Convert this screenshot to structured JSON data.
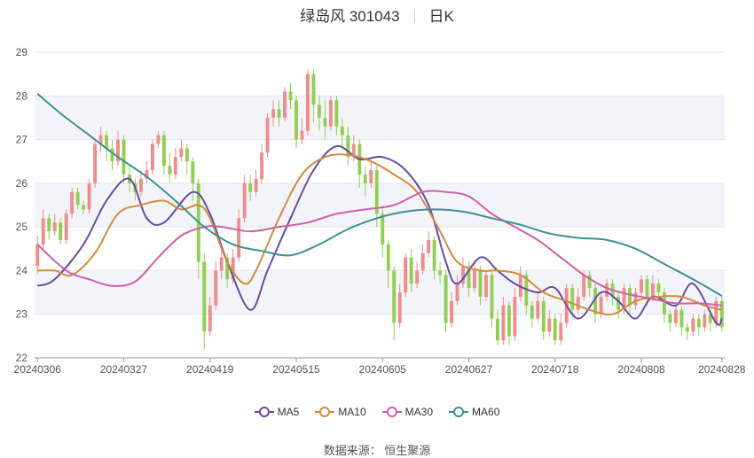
{
  "header": {
    "stock": "绿岛风 301043",
    "period": "日K"
  },
  "footer": {
    "source": "数据来源： 恒生聚源"
  },
  "colors": {
    "up": "#f28b8b",
    "down": "#8fd14f",
    "grid": "#e3e6ee",
    "band": "#f3f4f9"
  },
  "chart_data": {
    "type": "candlestick",
    "ylim": [
      22,
      29
    ],
    "yticks": [
      "22",
      "23",
      "24",
      "25",
      "26",
      "27",
      "28",
      "29"
    ],
    "xtick_labels": [
      "20240306",
      "20240327",
      "20240419",
      "20240515",
      "20240605",
      "20240627",
      "20240718",
      "20240808",
      "20240828"
    ],
    "xtick_index": [
      0,
      15,
      30,
      45,
      60,
      75,
      90,
      105,
      119
    ],
    "n_days": 120,
    "candles": [
      [
        24.1,
        24.6,
        23.9,
        24.8
      ],
      [
        24.6,
        25.2,
        24.5,
        25.4
      ],
      [
        25.2,
        24.9,
        24.7,
        25.3
      ],
      [
        24.9,
        25.1,
        24.8,
        25.3
      ],
      [
        25.1,
        24.7,
        24.6,
        25.2
      ],
      [
        24.7,
        25.3,
        24.6,
        25.4
      ],
      [
        25.3,
        25.8,
        25.2,
        25.9
      ],
      [
        25.8,
        25.5,
        25.4,
        25.9
      ],
      [
        25.5,
        25.4,
        25.3,
        25.6
      ],
      [
        25.4,
        26.0,
        25.3,
        26.1
      ],
      [
        26.0,
        26.9,
        25.9,
        27.0
      ],
      [
        26.9,
        27.1,
        26.7,
        27.3
      ],
      [
        27.1,
        26.8,
        26.5,
        27.2
      ],
      [
        26.8,
        26.5,
        26.3,
        27.0
      ],
      [
        26.5,
        27.0,
        26.4,
        27.2
      ],
      [
        27.0,
        26.2,
        26.0,
        27.1
      ],
      [
        26.2,
        26.0,
        25.8,
        26.4
      ],
      [
        26.0,
        25.8,
        25.6,
        26.1
      ],
      [
        25.8,
        26.1,
        25.7,
        26.3
      ],
      [
        26.1,
        26.3,
        26.0,
        26.5
      ],
      [
        26.3,
        26.9,
        26.2,
        27.0
      ],
      [
        26.9,
        27.1,
        26.8,
        27.2
      ],
      [
        27.1,
        26.4,
        26.2,
        27.2
      ],
      [
        26.4,
        26.2,
        26.0,
        26.7
      ],
      [
        26.2,
        26.6,
        26.1,
        26.8
      ],
      [
        26.6,
        26.8,
        26.5,
        27.0
      ],
      [
        26.8,
        26.5,
        26.2,
        26.9
      ],
      [
        26.5,
        26.0,
        25.6,
        26.6
      ],
      [
        26.0,
        24.2,
        23.8,
        26.1
      ],
      [
        24.2,
        22.6,
        22.2,
        24.4
      ],
      [
        22.6,
        23.2,
        22.5,
        23.4
      ],
      [
        23.2,
        24.0,
        23.1,
        24.2
      ],
      [
        24.0,
        24.3,
        23.8,
        24.5
      ],
      [
        24.3,
        23.8,
        23.6,
        24.4
      ],
      [
        23.8,
        24.3,
        23.7,
        24.5
      ],
      [
        24.3,
        25.2,
        24.2,
        25.4
      ],
      [
        25.2,
        26.0,
        25.1,
        26.2
      ],
      [
        26.0,
        25.8,
        25.6,
        26.2
      ],
      [
        25.8,
        26.1,
        25.7,
        26.3
      ],
      [
        26.1,
        26.7,
        26.0,
        26.9
      ],
      [
        26.7,
        27.5,
        26.6,
        27.6
      ],
      [
        27.5,
        27.7,
        27.3,
        27.9
      ],
      [
        27.7,
        27.5,
        27.3,
        27.9
      ],
      [
        27.5,
        28.1,
        27.4,
        28.2
      ],
      [
        28.1,
        27.9,
        27.7,
        28.3
      ],
      [
        27.9,
        27.0,
        26.8,
        28.0
      ],
      [
        27.0,
        27.2,
        26.9,
        27.5
      ],
      [
        27.2,
        28.5,
        27.1,
        28.6
      ],
      [
        28.5,
        27.8,
        27.4,
        28.6
      ],
      [
        27.8,
        27.5,
        27.2,
        28.0
      ],
      [
        27.5,
        27.3,
        27.0,
        27.9
      ],
      [
        27.3,
        27.9,
        27.2,
        28.0
      ],
      [
        27.9,
        27.3,
        27.1,
        28.0
      ],
      [
        27.3,
        27.1,
        26.8,
        27.5
      ],
      [
        27.1,
        26.6,
        26.4,
        27.3
      ],
      [
        26.6,
        26.9,
        26.5,
        27.1
      ],
      [
        26.9,
        26.2,
        25.9,
        27.0
      ],
      [
        26.2,
        26.0,
        25.7,
        26.4
      ],
      [
        26.0,
        26.3,
        25.9,
        26.5
      ],
      [
        26.3,
        25.3,
        25.0,
        26.4
      ],
      [
        25.3,
        24.6,
        24.3,
        25.5
      ],
      [
        24.6,
        24.0,
        23.6,
        24.7
      ],
      [
        24.0,
        22.8,
        22.4,
        24.1
      ],
      [
        22.8,
        23.5,
        22.7,
        23.7
      ],
      [
        23.5,
        24.3,
        23.4,
        24.4
      ],
      [
        24.3,
        23.7,
        23.5,
        24.5
      ],
      [
        23.7,
        24.0,
        23.6,
        24.2
      ],
      [
        24.0,
        24.4,
        23.9,
        24.6
      ],
      [
        24.4,
        24.7,
        24.3,
        24.9
      ],
      [
        24.7,
        24.0,
        23.8,
        24.8
      ],
      [
        24.0,
        23.9,
        23.7,
        24.2
      ],
      [
        23.9,
        22.8,
        22.6,
        24.0
      ],
      [
        22.8,
        23.3,
        22.7,
        23.5
      ],
      [
        23.3,
        23.7,
        23.2,
        23.9
      ],
      [
        23.7,
        24.1,
        23.6,
        24.3
      ],
      [
        24.1,
        23.6,
        23.4,
        24.2
      ],
      [
        23.6,
        24.0,
        23.5,
        24.2
      ],
      [
        24.0,
        23.4,
        23.2,
        24.1
      ],
      [
        23.4,
        23.9,
        23.3,
        24.0
      ],
      [
        23.9,
        22.9,
        22.7,
        24.0
      ],
      [
        22.9,
        22.4,
        22.3,
        23.1
      ],
      [
        22.4,
        23.2,
        22.3,
        23.4
      ],
      [
        23.2,
        22.5,
        22.3,
        23.3
      ],
      [
        22.5,
        23.4,
        22.4,
        23.6
      ],
      [
        23.4,
        23.9,
        23.3,
        24.1
      ],
      [
        23.9,
        23.2,
        23.0,
        24.0
      ],
      [
        23.2,
        22.9,
        22.7,
        23.3
      ],
      [
        22.9,
        23.3,
        22.8,
        23.5
      ],
      [
        23.3,
        22.6,
        22.4,
        23.4
      ],
      [
        22.6,
        22.9,
        22.5,
        23.1
      ],
      [
        22.9,
        22.4,
        22.3,
        23.0
      ],
      [
        22.4,
        22.8,
        22.3,
        23.0
      ],
      [
        22.8,
        23.6,
        22.7,
        23.7
      ],
      [
        23.6,
        23.1,
        22.9,
        23.7
      ],
      [
        23.1,
        23.4,
        23.0,
        23.6
      ],
      [
        23.4,
        23.9,
        23.3,
        24.0
      ],
      [
        23.9,
        23.6,
        23.4,
        24.0
      ],
      [
        23.6,
        23.0,
        22.8,
        23.7
      ],
      [
        23.0,
        23.4,
        22.9,
        23.5
      ],
      [
        23.4,
        23.7,
        23.3,
        23.8
      ],
      [
        23.7,
        23.4,
        23.2,
        23.8
      ],
      [
        23.4,
        23.1,
        22.9,
        23.5
      ],
      [
        23.1,
        23.6,
        23.0,
        23.7
      ],
      [
        23.6,
        23.2,
        23.0,
        23.7
      ],
      [
        23.2,
        23.5,
        23.1,
        23.6
      ],
      [
        23.5,
        23.8,
        23.4,
        23.9
      ],
      [
        23.8,
        23.4,
        23.2,
        23.9
      ],
      [
        23.4,
        23.7,
        23.3,
        23.9
      ],
      [
        23.7,
        23.5,
        23.3,
        23.8
      ],
      [
        23.5,
        23.0,
        22.8,
        23.6
      ],
      [
        23.0,
        22.8,
        22.6,
        23.1
      ],
      [
        22.8,
        23.1,
        22.7,
        23.2
      ],
      [
        23.1,
        22.7,
        22.5,
        23.2
      ],
      [
        22.7,
        22.6,
        22.4,
        22.8
      ],
      [
        22.6,
        22.9,
        22.5,
        23.0
      ],
      [
        22.9,
        22.7,
        22.5,
        23.0
      ],
      [
        22.7,
        23.0,
        22.6,
        23.1
      ],
      [
        23.0,
        22.8,
        22.6,
        23.1
      ],
      [
        22.8,
        23.3,
        22.7,
        23.4
      ],
      [
        23.3,
        22.7,
        22.6,
        23.4
      ]
    ],
    "series": [
      {
        "name": "MA5",
        "color": "#6a4aa6",
        "knots": [
          [
            0,
            23.65
          ],
          [
            3,
            23.8
          ],
          [
            8,
            24.6
          ],
          [
            12,
            25.6
          ],
          [
            16,
            26.1
          ],
          [
            19,
            25.2
          ],
          [
            22,
            25.1
          ],
          [
            27,
            25.8
          ],
          [
            30,
            25.3
          ],
          [
            33,
            24.2
          ],
          [
            37,
            23.1
          ],
          [
            40,
            24.0
          ],
          [
            44,
            25.2
          ],
          [
            48,
            26.3
          ],
          [
            52,
            26.85
          ],
          [
            56,
            26.55
          ],
          [
            60,
            26.6
          ],
          [
            64,
            26.3
          ],
          [
            68,
            25.5
          ],
          [
            71,
            24.2
          ],
          [
            73,
            23.7
          ],
          [
            77,
            24.3
          ],
          [
            80,
            24.0
          ],
          [
            83,
            23.7
          ],
          [
            87,
            23.5
          ],
          [
            90,
            23.6
          ],
          [
            94,
            22.9
          ],
          [
            98,
            23.5
          ],
          [
            101,
            23.3
          ],
          [
            104,
            22.9
          ],
          [
            107,
            23.4
          ],
          [
            111,
            23.2
          ],
          [
            114,
            23.7
          ],
          [
            118,
            22.8
          ],
          [
            119,
            22.9
          ]
        ]
      },
      {
        "name": "MA10",
        "color": "#d38c3b",
        "knots": [
          [
            0,
            24.0
          ],
          [
            3,
            24.0
          ],
          [
            6,
            23.9
          ],
          [
            10,
            24.4
          ],
          [
            14,
            25.3
          ],
          [
            18,
            25.5
          ],
          [
            22,
            25.6
          ],
          [
            25,
            25.4
          ],
          [
            28,
            25.5
          ],
          [
            30,
            25.2
          ],
          [
            33,
            24.2
          ],
          [
            36,
            23.7
          ],
          [
            38,
            24.0
          ],
          [
            42,
            25.2
          ],
          [
            46,
            26.2
          ],
          [
            50,
            26.6
          ],
          [
            54,
            26.65
          ],
          [
            58,
            26.5
          ],
          [
            62,
            26.2
          ],
          [
            66,
            25.8
          ],
          [
            70,
            24.9
          ],
          [
            73,
            24.2
          ],
          [
            77,
            24.0
          ],
          [
            80,
            24.0
          ],
          [
            84,
            23.9
          ],
          [
            88,
            23.5
          ],
          [
            92,
            23.3
          ],
          [
            96,
            23.1
          ],
          [
            100,
            23.0
          ],
          [
            104,
            23.3
          ],
          [
            108,
            23.4
          ],
          [
            112,
            23.4
          ],
          [
            116,
            23.2
          ],
          [
            119,
            23.1
          ]
        ]
      },
      {
        "name": "MA30",
        "color": "#d25ea9",
        "knots": [
          [
            0,
            24.6
          ],
          [
            5,
            24.0
          ],
          [
            9,
            23.8
          ],
          [
            13,
            23.65
          ],
          [
            17,
            23.75
          ],
          [
            21,
            24.3
          ],
          [
            25,
            24.8
          ],
          [
            29,
            25.0
          ],
          [
            32,
            25.0
          ],
          [
            37,
            24.9
          ],
          [
            42,
            25.0
          ],
          [
            47,
            25.1
          ],
          [
            52,
            25.3
          ],
          [
            57,
            25.4
          ],
          [
            62,
            25.5
          ],
          [
            67,
            25.8
          ],
          [
            71,
            25.8
          ],
          [
            75,
            25.7
          ],
          [
            79,
            25.3
          ],
          [
            83,
            25.0
          ],
          [
            87,
            24.7
          ],
          [
            91,
            24.3
          ],
          [
            95,
            23.9
          ],
          [
            99,
            23.6
          ],
          [
            103,
            23.45
          ],
          [
            107,
            23.35
          ],
          [
            111,
            23.25
          ],
          [
            115,
            23.25
          ],
          [
            119,
            23.2
          ]
        ]
      },
      {
        "name": "MA60",
        "color": "#3a9294",
        "knots": [
          [
            0,
            28.05
          ],
          [
            4,
            27.6
          ],
          [
            9,
            27.1
          ],
          [
            14,
            26.6
          ],
          [
            19,
            26.15
          ],
          [
            24,
            25.6
          ],
          [
            29,
            25.0
          ],
          [
            34,
            24.6
          ],
          [
            39,
            24.45
          ],
          [
            44,
            24.35
          ],
          [
            49,
            24.6
          ],
          [
            54,
            24.95
          ],
          [
            59,
            25.2
          ],
          [
            64,
            25.35
          ],
          [
            69,
            25.4
          ],
          [
            74,
            25.35
          ],
          [
            79,
            25.2
          ],
          [
            84,
            25.05
          ],
          [
            89,
            24.85
          ],
          [
            94,
            24.75
          ],
          [
            99,
            24.7
          ],
          [
            104,
            24.5
          ],
          [
            109,
            24.15
          ],
          [
            114,
            23.8
          ],
          [
            119,
            23.42
          ]
        ]
      }
    ]
  }
}
